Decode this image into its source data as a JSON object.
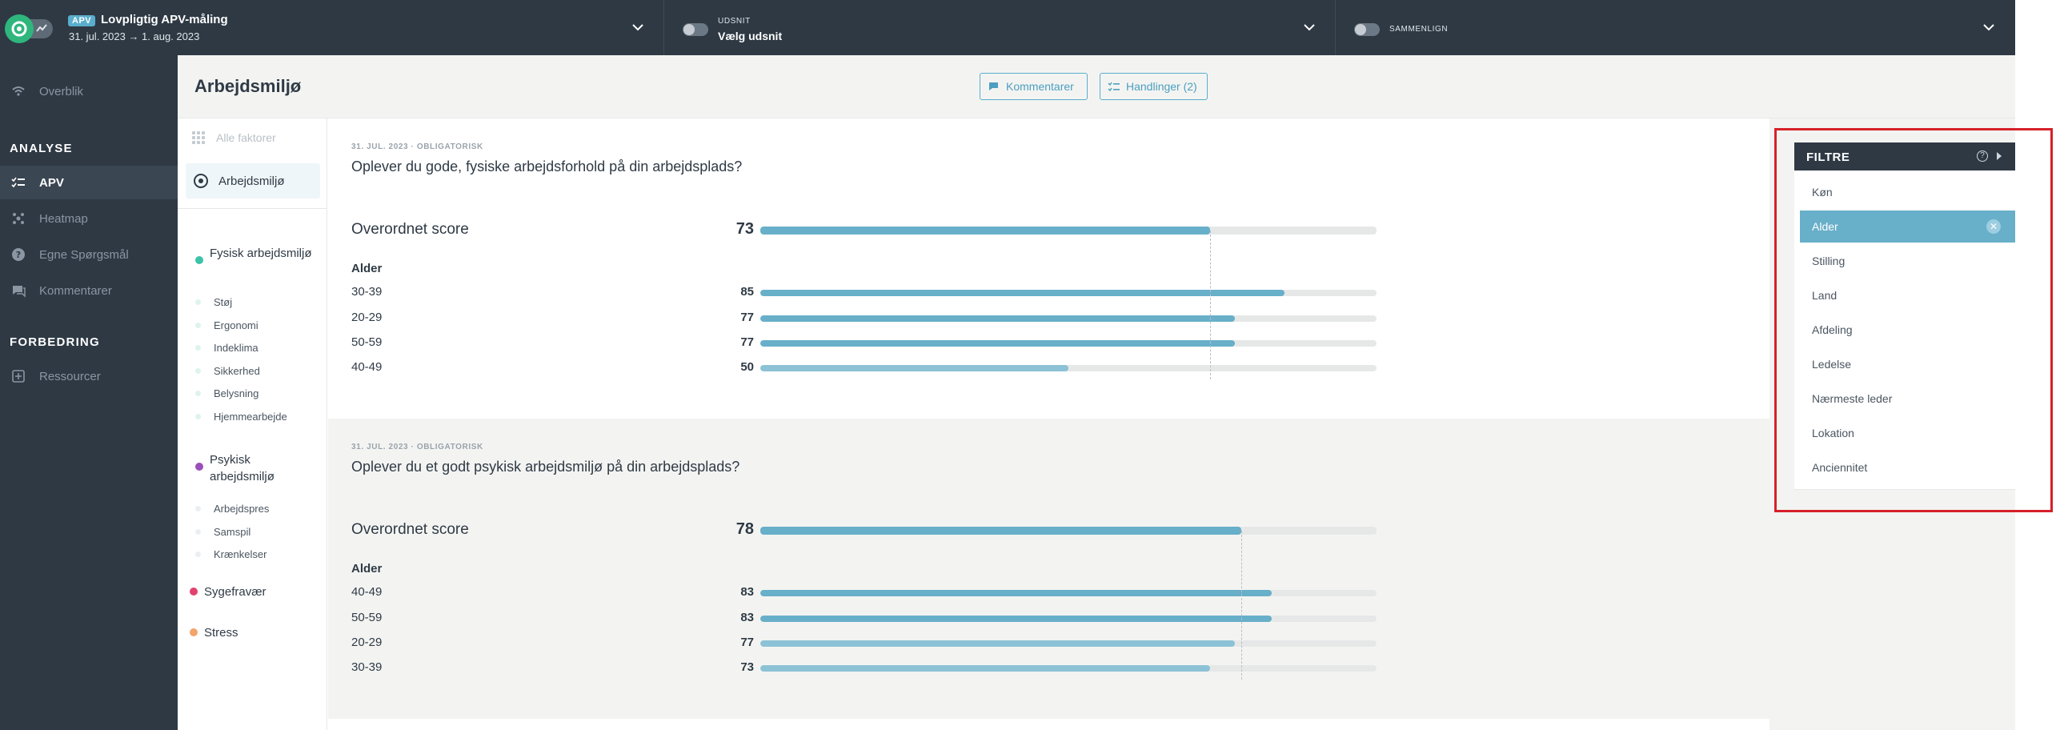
{
  "topbar": {
    "apv_badge": "APV",
    "survey_title": "Lovpligtig APV-måling",
    "survey_dates": "31. jul. 2023 → 1. aug. 2023",
    "segment_label": "UDSNIT",
    "segment_value": "Vælg udsnit",
    "compare_label": "SAMMENLIGN"
  },
  "nav": {
    "overview": "Overblik",
    "analysis_section": "ANALYSE",
    "apv": "APV",
    "heatmap": "Heatmap",
    "own_questions": "Egne Spørgsmål",
    "comments": "Kommentarer",
    "improvement_section": "FORBEDRING",
    "resources": "Ressourcer"
  },
  "header": {
    "title": "Arbejdsmiljø",
    "comments_button": "Kommentarer",
    "actions_button": "Handlinger (2)"
  },
  "factors": {
    "all": "Alle faktorer",
    "selected": "Arbejdsmiljø",
    "physical": "Fysisk arbejdsmiljø",
    "physical_color": "#3cc3a8",
    "physical_items": [
      "Støj",
      "Ergonomi",
      "Indeklima",
      "Sikkerhed",
      "Belysning",
      "Hjemmearbejde"
    ],
    "psych": "Psykisk arbejdsmiljø",
    "psych_color": "#9b4fb8",
    "psych_items": [
      "Arbejdspres",
      "Samspil",
      "Krænkelser"
    ],
    "sick": "Sygefravær",
    "sick_color": "#e0436e",
    "stress": "Stress",
    "stress_color": "#f2a46b"
  },
  "questions": [
    {
      "meta": "31. JUL. 2023 · OBLIGATORISK",
      "title": "Oplever du gode, fysiske arbejdsforhold på din arbejdsplads?",
      "overall_label": "Overordnet score",
      "overall_score": 73,
      "group_label": "Alder",
      "rows": [
        {
          "label": "30-39",
          "value": 85
        },
        {
          "label": "20-29",
          "value": 77
        },
        {
          "label": "50-59",
          "value": 77
        },
        {
          "label": "40-49",
          "value": 50
        }
      ]
    },
    {
      "meta": "31. JUL. 2023 · OBLIGATORISK",
      "title": "Oplever du et godt psykisk arbejdsmiljø på din arbejdsplads?",
      "overall_label": "Overordnet score",
      "overall_score": 78,
      "group_label": "Alder",
      "rows": [
        {
          "label": "40-49",
          "value": 83
        },
        {
          "label": "50-59",
          "value": 83
        },
        {
          "label": "20-29",
          "value": 77
        },
        {
          "label": "30-39",
          "value": 73
        }
      ]
    }
  ],
  "filters": {
    "title": "FILTRE",
    "help_icon": "?",
    "items": [
      "Køn",
      "Alder",
      "Stilling",
      "Land",
      "Afdeling",
      "Ledelse",
      "Nærmeste leder",
      "Lokation",
      "Anciennitet"
    ],
    "active": "Alder"
  },
  "colors": {
    "accent": "#5aaecd",
    "bar_fill": "#68afc9",
    "nav_bg": "#2e3944",
    "highlight": "#d6202a"
  }
}
